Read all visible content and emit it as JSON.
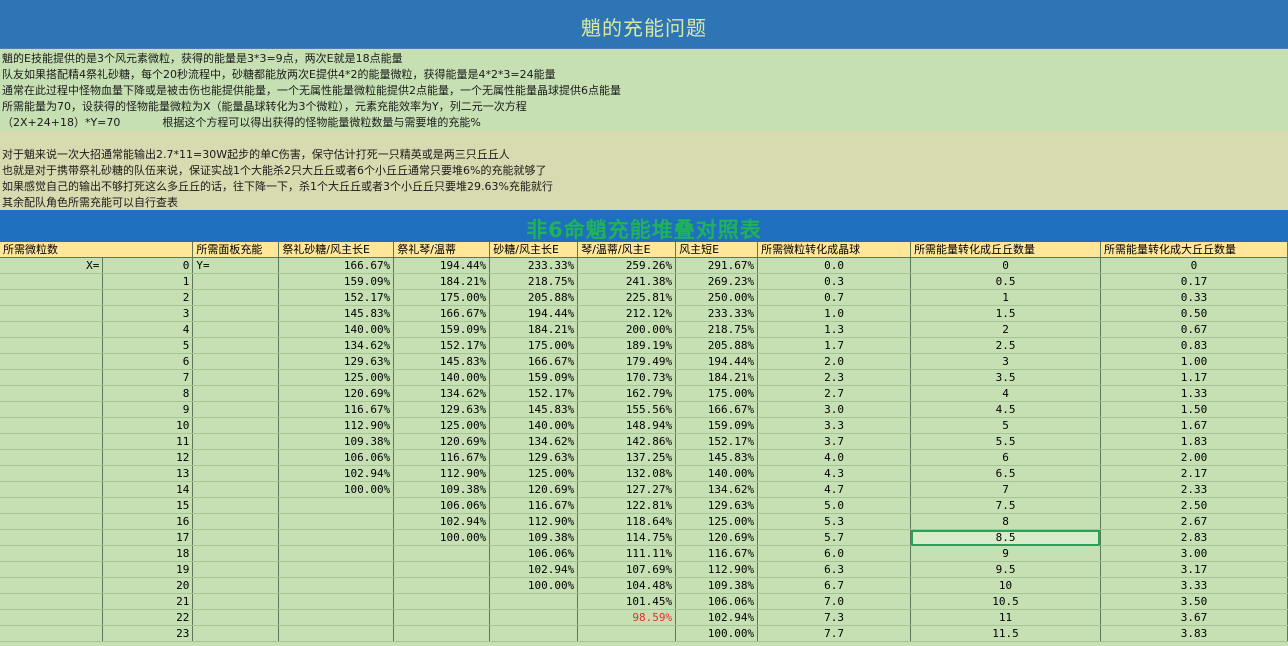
{
  "title": "魈的充能问题",
  "notes": [
    "魈的E技能提供的是3个风元素微粒，获得的能量是3*3=9点，两次E就是18点能量",
    "队友如果搭配精4祭礼砂糖，每个20秒流程中，砂糖都能放两次E提供4*2的能量微粒，获得能量是4*2*3=24能量",
    "通常在此过程中怪物血量下降或是被击伤也能提供能量，一个无属性能量微粒能提供2点能量，一个无属性能量晶球提供6点能量",
    "所需能量为70，设获得的怪物能量微粒为X（能量晶球转化为3个微粒），元素充能效率为Y，列二元一次方程",
    "（2X+24+18）*Y=70            根据这个方程可以得出获得的怪物能量微粒数量与需要堆的充能%"
  ],
  "notes2": [
    "对于魈来说一次大招通常能输出2.7*11=30W起步的单C伤害，保守估计打死一只精英或是两三只丘丘人",
    "也就是对于携带祭礼砂糖的队伍来说，保证实战1个大能杀2只大丘丘或者6个小丘丘通常只要堆6%的充能就够了",
    "如果感觉自己的输出不够打死这么多丘丘的话，往下降一下，杀1个大丘丘或者3个小丘丘只要堆29.63%充能就行",
    "其余配队角色所需充能可以自行查表"
  ],
  "table_title": "非6命魈充能堆叠对照表",
  "columns": [
    "所需微粒数",
    "所需面板充能",
    "祭礼砂糖/风主长E",
    "祭礼琴/温蒂",
    "砂糖/风主长E",
    "琴/温蒂/风主E",
    "风主短E",
    "所需微粒转化成晶球",
    "所需能量转化成丘丘数量",
    "所需能量转化成大丘丘数量"
  ],
  "rows": [
    [
      "X=",
      "0",
      "Y=",
      "166.67%",
      "194.44%",
      "233.33%",
      "259.26%",
      "291.67%",
      "0.0",
      "0",
      "0"
    ],
    [
      "",
      "1",
      "",
      "159.09%",
      "184.21%",
      "218.75%",
      "241.38%",
      "269.23%",
      "0.3",
      "0.5",
      "0.17"
    ],
    [
      "",
      "2",
      "",
      "152.17%",
      "175.00%",
      "205.88%",
      "225.81%",
      "250.00%",
      "0.7",
      "1",
      "0.33"
    ],
    [
      "",
      "3",
      "",
      "145.83%",
      "166.67%",
      "194.44%",
      "212.12%",
      "233.33%",
      "1.0",
      "1.5",
      "0.50"
    ],
    [
      "",
      "4",
      "",
      "140.00%",
      "159.09%",
      "184.21%",
      "200.00%",
      "218.75%",
      "1.3",
      "2",
      "0.67"
    ],
    [
      "",
      "5",
      "",
      "134.62%",
      "152.17%",
      "175.00%",
      "189.19%",
      "205.88%",
      "1.7",
      "2.5",
      "0.83"
    ],
    [
      "",
      "6",
      "",
      "129.63%",
      "145.83%",
      "166.67%",
      "179.49%",
      "194.44%",
      "2.0",
      "3",
      "1.00"
    ],
    [
      "",
      "7",
      "",
      "125.00%",
      "140.00%",
      "159.09%",
      "170.73%",
      "184.21%",
      "2.3",
      "3.5",
      "1.17"
    ],
    [
      "",
      "8",
      "",
      "120.69%",
      "134.62%",
      "152.17%",
      "162.79%",
      "175.00%",
      "2.7",
      "4",
      "1.33"
    ],
    [
      "",
      "9",
      "",
      "116.67%",
      "129.63%",
      "145.83%",
      "155.56%",
      "166.67%",
      "3.0",
      "4.5",
      "1.50"
    ],
    [
      "",
      "10",
      "",
      "112.90%",
      "125.00%",
      "140.00%",
      "148.94%",
      "159.09%",
      "3.3",
      "5",
      "1.67"
    ],
    [
      "",
      "11",
      "",
      "109.38%",
      "120.69%",
      "134.62%",
      "142.86%",
      "152.17%",
      "3.7",
      "5.5",
      "1.83"
    ],
    [
      "",
      "12",
      "",
      "106.06%",
      "116.67%",
      "129.63%",
      "137.25%",
      "145.83%",
      "4.0",
      "6",
      "2.00"
    ],
    [
      "",
      "13",
      "",
      "102.94%",
      "112.90%",
      "125.00%",
      "132.08%",
      "140.00%",
      "4.3",
      "6.5",
      "2.17"
    ],
    [
      "",
      "14",
      "",
      "100.00%",
      "109.38%",
      "120.69%",
      "127.27%",
      "134.62%",
      "4.7",
      "7",
      "2.33"
    ],
    [
      "",
      "15",
      "",
      "",
      "106.06%",
      "116.67%",
      "122.81%",
      "129.63%",
      "5.0",
      "7.5",
      "2.50"
    ],
    [
      "",
      "16",
      "",
      "",
      "102.94%",
      "112.90%",
      "118.64%",
      "125.00%",
      "5.3",
      "8",
      "2.67"
    ],
    [
      "",
      "17",
      "",
      "",
      "100.00%",
      "109.38%",
      "114.75%",
      "120.69%",
      "5.7",
      "8.5",
      "2.83"
    ],
    [
      "",
      "18",
      "",
      "",
      "",
      "106.06%",
      "111.11%",
      "116.67%",
      "6.0",
      "9",
      "3.00"
    ],
    [
      "",
      "19",
      "",
      "",
      "",
      "102.94%",
      "107.69%",
      "112.90%",
      "6.3",
      "9.5",
      "3.17"
    ],
    [
      "",
      "20",
      "",
      "",
      "",
      "100.00%",
      "104.48%",
      "109.38%",
      "6.7",
      "10",
      "3.33"
    ],
    [
      "",
      "21",
      "",
      "",
      "",
      "",
      "101.45%",
      "106.06%",
      "7.0",
      "10.5",
      "3.50"
    ],
    [
      "",
      "22",
      "",
      "",
      "",
      "",
      "98.59%",
      "102.94%",
      "7.3",
      "11",
      "3.67"
    ],
    [
      "",
      "23",
      "",
      "",
      "",
      "",
      "",
      "100.00%",
      "7.7",
      "11.5",
      "3.83"
    ]
  ],
  "highlight": {
    "red_value_color": "#e03030",
    "selected_value": "8.5"
  }
}
